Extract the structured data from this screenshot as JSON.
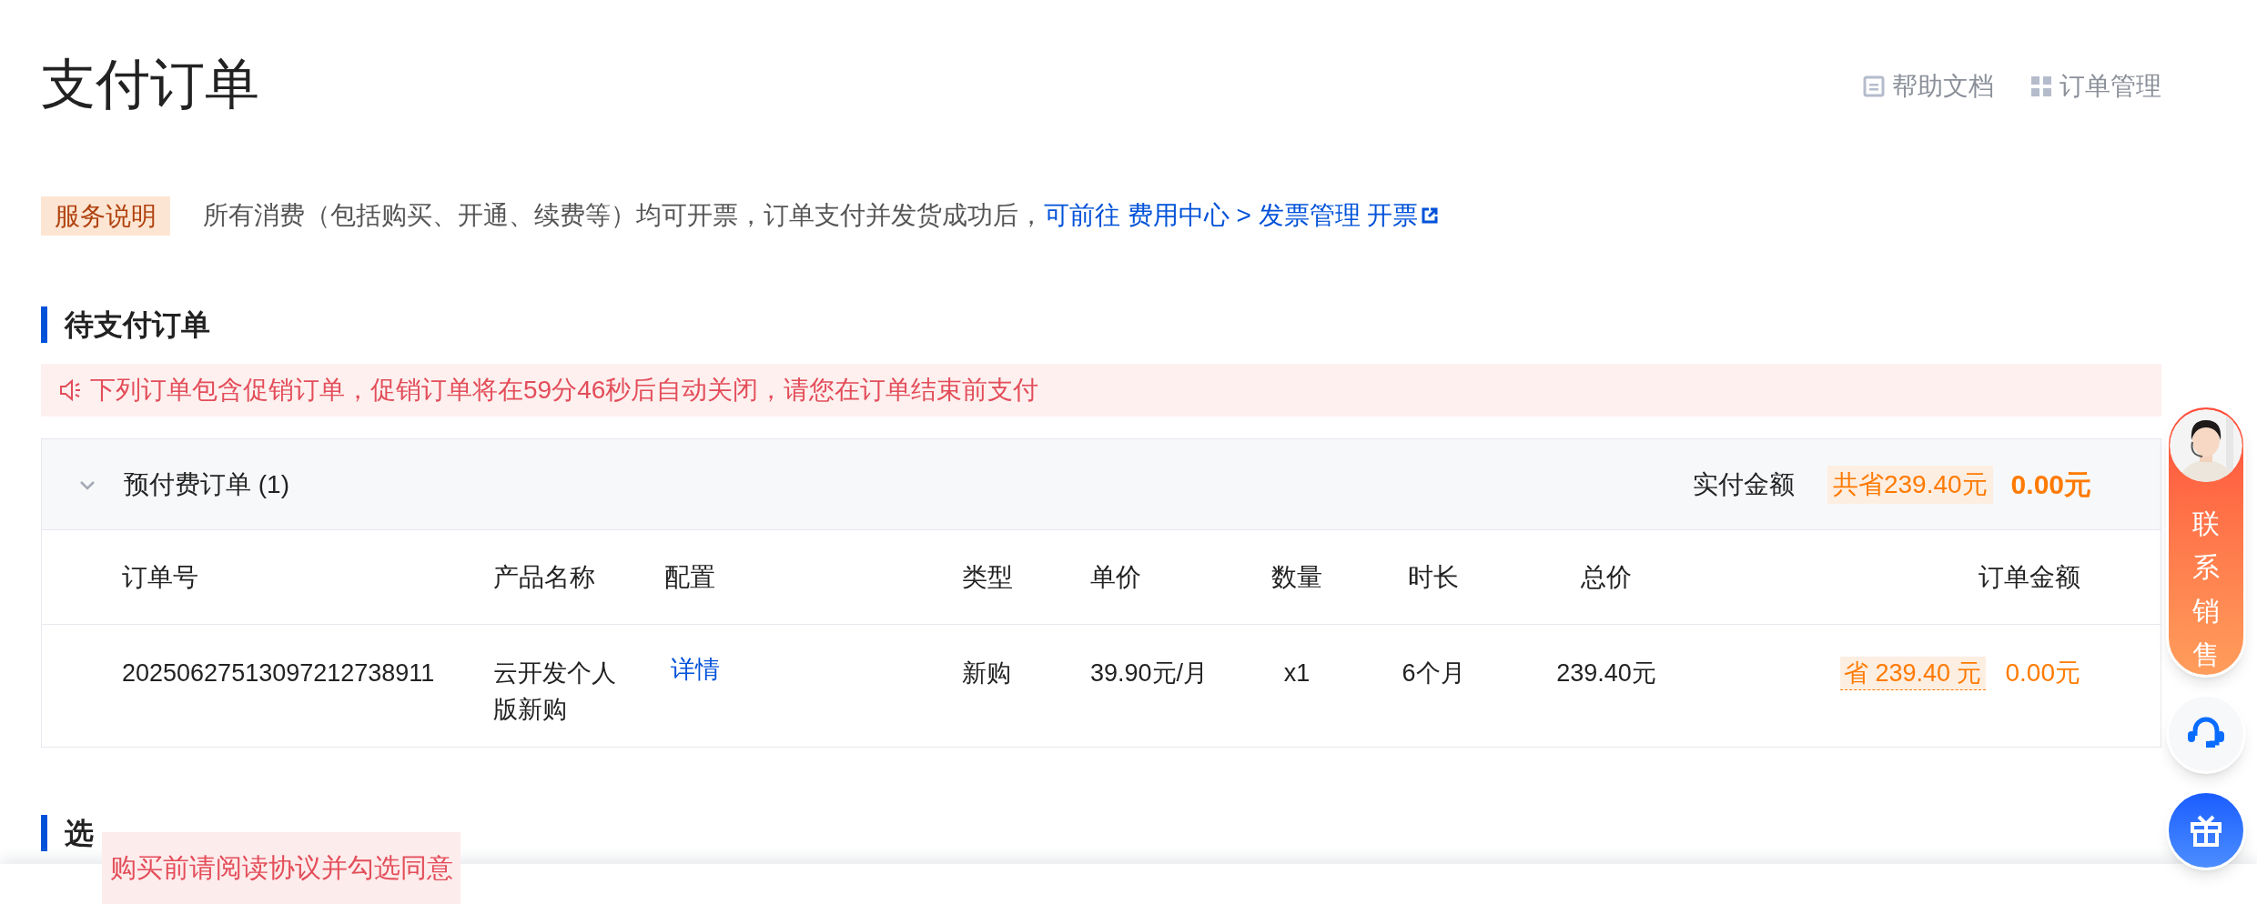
{
  "page": {
    "title": "支付订单"
  },
  "header_links": [
    {
      "label": "帮助文档",
      "kind": "doc"
    },
    {
      "label": "订单管理",
      "kind": "grid"
    }
  ],
  "service_note": {
    "tag": "服务说明",
    "text": "所有消费（包括购买、开通、续费等）均可开票，订单支付并发货成功后，",
    "link": "可前往 费用中心 > 发票管理 开票"
  },
  "pending": {
    "title": "待支付订单",
    "alert": "下列订单包含促销订单，促销订单将在59分46秒后自动关闭，请您在订单结束前支付",
    "groups": [
      {
        "name": "预付费订单 (1)",
        "expanded": true,
        "paid_label": "实付金额",
        "saving": "共省239.40元",
        "paid_amount": "0.00元",
        "columns": [
          "订单号",
          "产品名称",
          "配置",
          "类型",
          "单价",
          "数量",
          "时长",
          "总价",
          "订单金额"
        ],
        "rows": [
          {
            "order_no": "20250627513097212738911",
            "product": "云开发个人版新购",
            "config": "详情",
            "type": "新购",
            "unit_price": "39.90元/月",
            "quantity": "x1",
            "duration": "6个月",
            "total": "239.40元",
            "saving": "省 239.40 元",
            "amount": "0.00元"
          }
        ]
      }
    ]
  },
  "payment_section": {
    "title": "选"
  },
  "toast": "购买前请阅读协议并勾选同意",
  "float_buttons": [
    {
      "kind": "sales",
      "label": "联系销售"
    },
    {
      "kind": "support"
    },
    {
      "kind": "gift"
    }
  ]
}
